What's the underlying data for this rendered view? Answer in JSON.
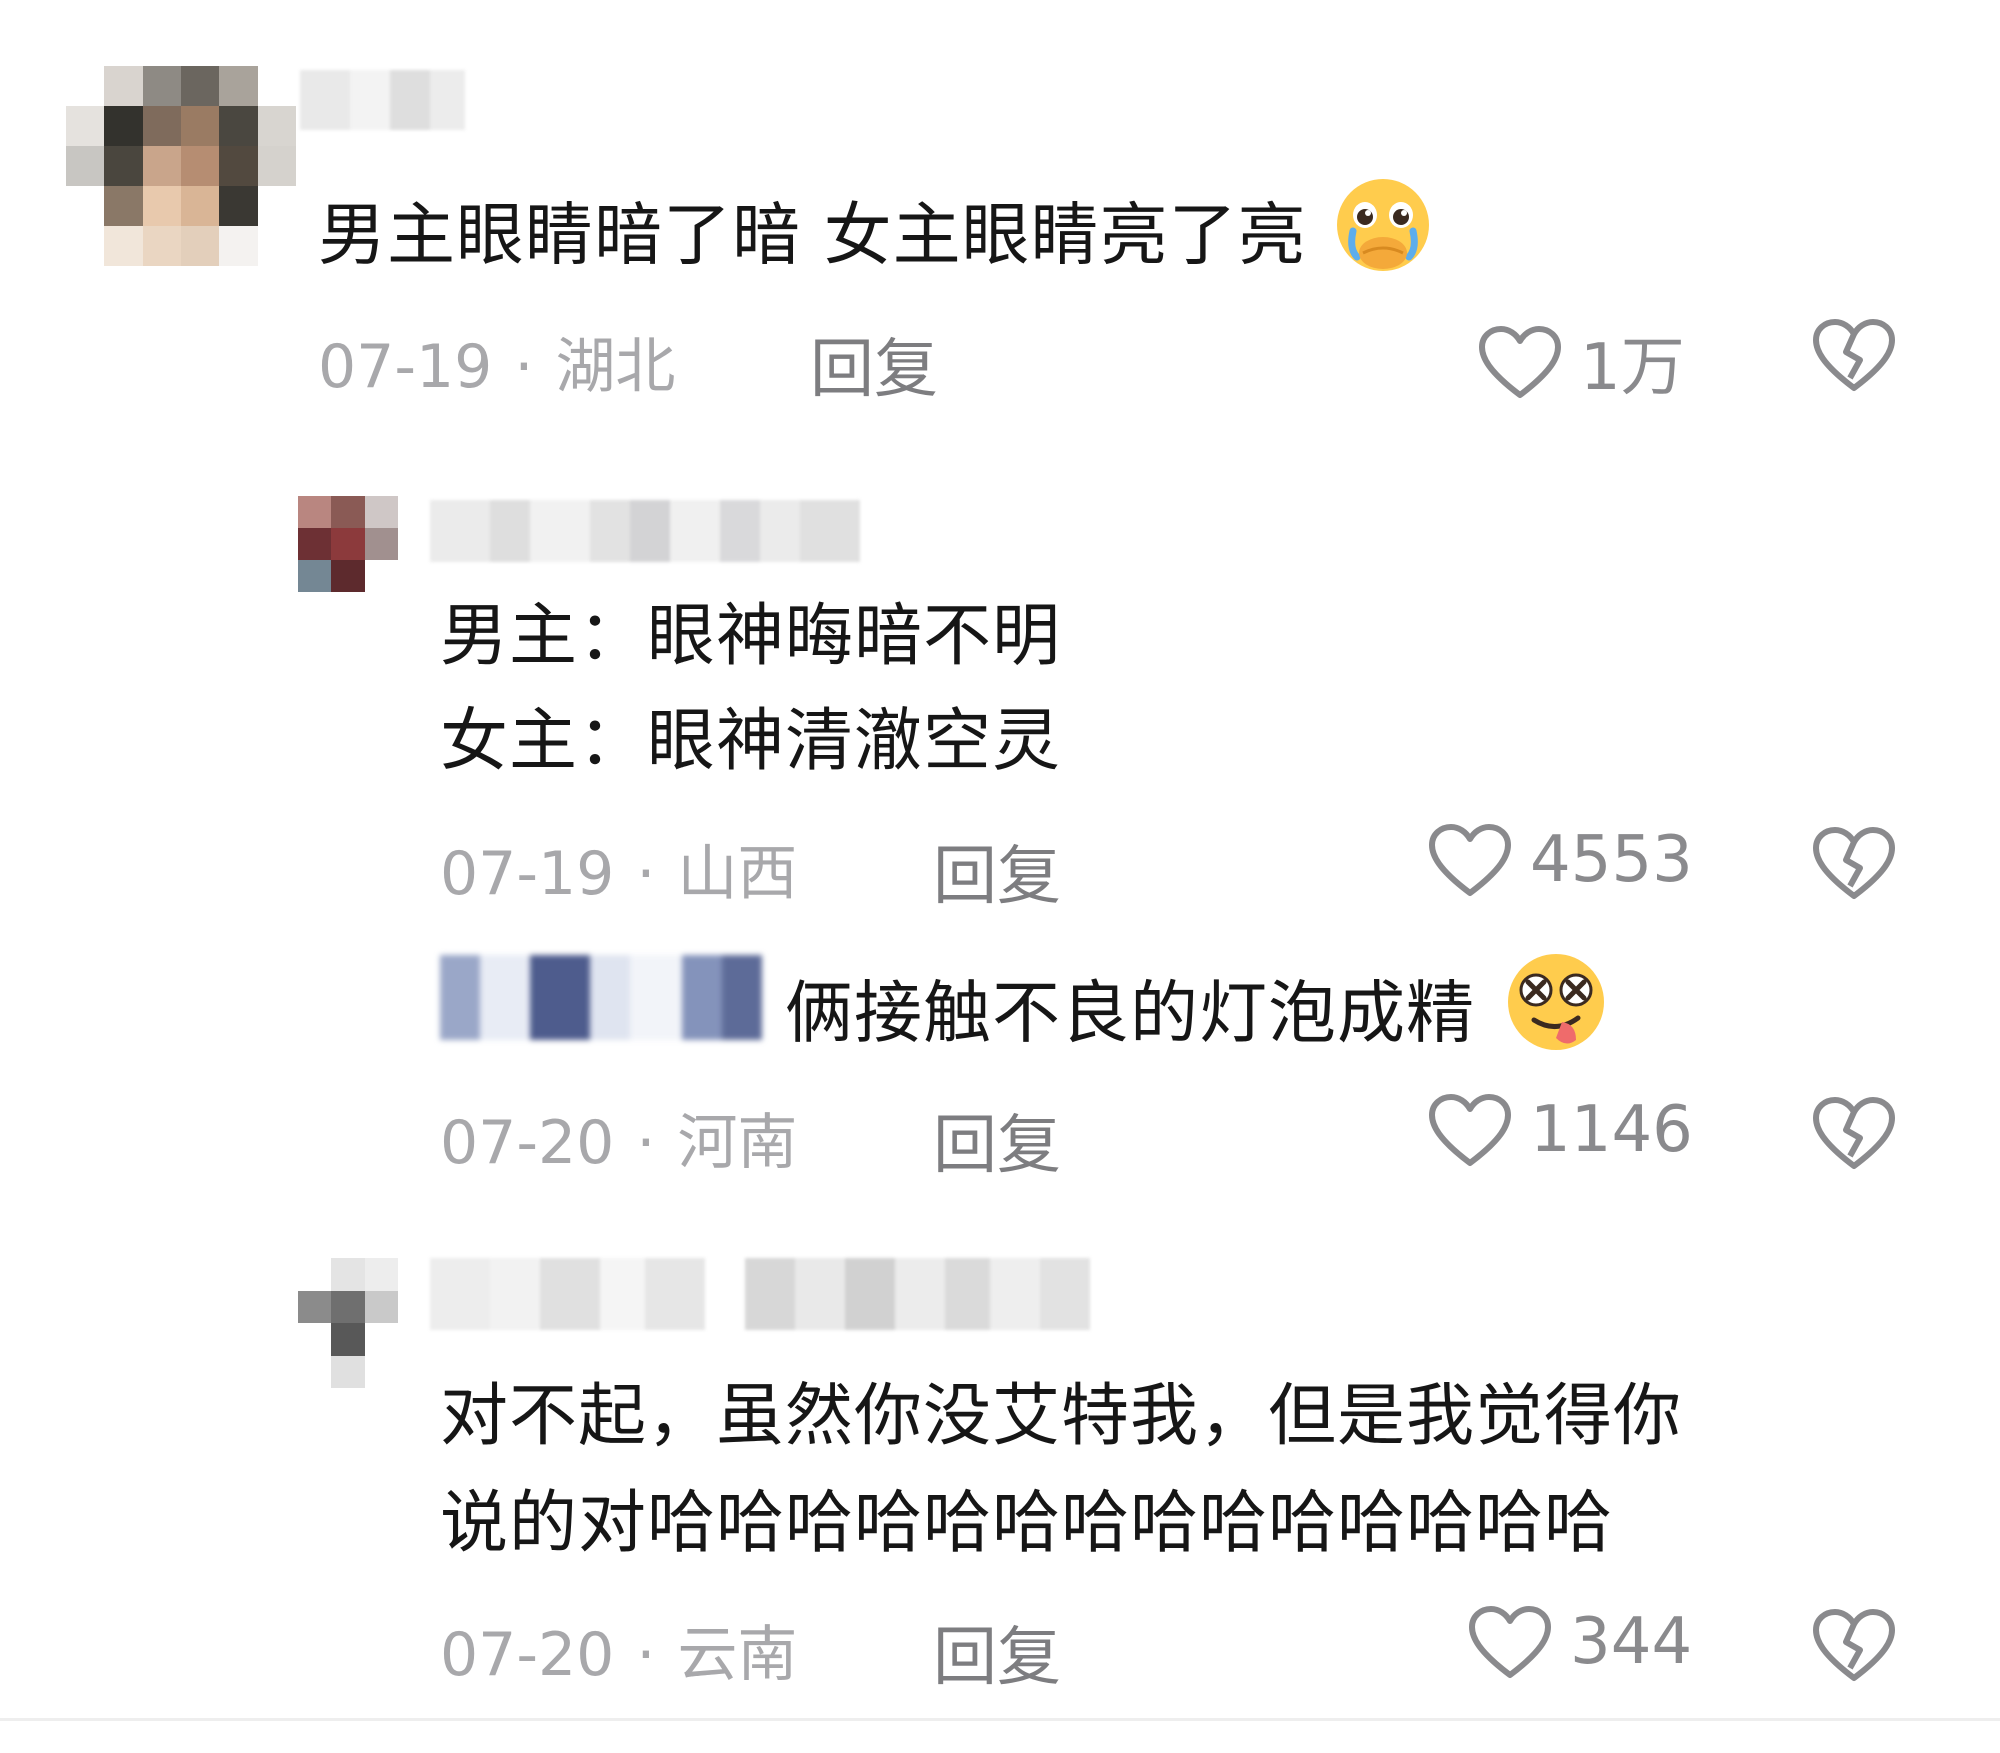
{
  "comments": [
    {
      "text": "男主眼睛暗了暗 女主眼睛亮了亮",
      "emoji": "pleading-face-emoji",
      "date": "07-19",
      "location": "湖北",
      "reply_label": "回复",
      "likes": "1万"
    },
    {
      "line1": "男主：眼神晦暗不明",
      "line2": "女主：眼神清澈空灵",
      "date": "07-19",
      "location": "山西",
      "reply_label": "回复",
      "likes": "4553"
    },
    {
      "text": "俩接触不良的灯泡成精",
      "emoji": "dizzy-tongue-face-emoji",
      "date": "07-20",
      "location": "河南",
      "reply_label": "回复",
      "likes": "1146"
    },
    {
      "line1": "对不起，虽然你没艾特我，但是我觉得你",
      "line2": "说的对哈哈哈哈哈哈哈哈哈哈哈哈哈哈",
      "date": "07-20",
      "location": "云南",
      "reply_label": "回复",
      "likes": "344"
    }
  ],
  "icons": {
    "like": "heart-outline-icon",
    "dislike": "broken-heart-icon"
  },
  "colors": {
    "text": "#161616",
    "meta": "#a8a8ab",
    "icon": "#8a8a8d"
  }
}
